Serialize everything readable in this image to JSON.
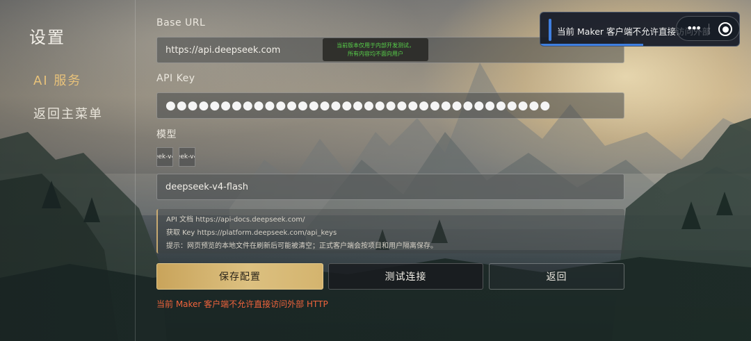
{
  "sidebar": {
    "title": "设置",
    "items": [
      {
        "label": "AI 服务"
      },
      {
        "label": "返回主菜单"
      }
    ]
  },
  "form": {
    "base_url": {
      "label": "Base URL",
      "value": "https://api.deepseek.com"
    },
    "api_key": {
      "label": "API Key",
      "value": "●●●●●●●●●●●●●●●●●●●●●●●●●●●●●●●●●●●"
    },
    "model": {
      "label": "模型",
      "chips": [
        "eek-v4",
        "eek-v4"
      ],
      "value": "deepseek-v4-flash"
    },
    "info": {
      "line1": "API 文档  https://api-docs.deepseek.com/",
      "line2": "获取 Key  https://platform.deepseek.com/api_keys",
      "line3": "提示：网页预览的本地文件在刷新后可能被清空；正式客户端会按项目和用户隔离保存。"
    }
  },
  "buttons": {
    "save": "保存配置",
    "test": "测试连接",
    "back": "返回"
  },
  "error": "当前 Maker 客户端不允许直接访问外部 HTTP",
  "dev_banner": {
    "line1": "当前版本仅用于内部开发测试，",
    "line2": "所有内容均不面向用户"
  },
  "toast": {
    "message": "当前 Maker 客户端不允许直接访问外部"
  },
  "capsule": {
    "dots": "•••"
  },
  "colors": {
    "accent": "#e8c27a",
    "error": "#f0643c",
    "toast_bar": "#3f7fe0",
    "banner_text": "#58d04a"
  }
}
